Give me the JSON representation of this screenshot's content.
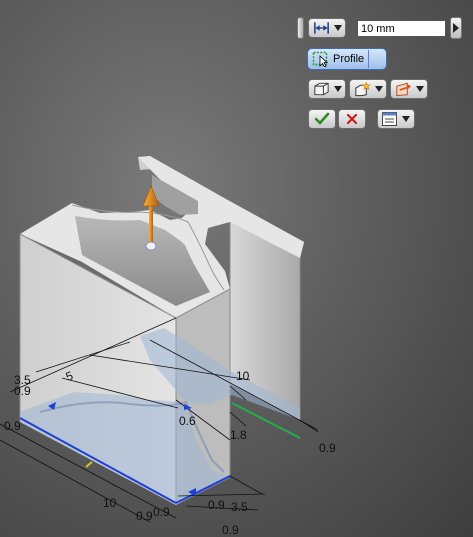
{
  "toolbar": {
    "distance_value": "10 mm",
    "profile_label": "Profile",
    "distance_icon": "extents-distance-icon",
    "output_icon": "output-solid-icon",
    "direction_icon": "direction-icon",
    "operation_icon": "join-operation-icon",
    "ok_icon": "check-icon",
    "cancel_icon": "cancel-x-icon",
    "more_icon": "options-menu-icon"
  },
  "dimensions": {
    "d_3_5_left": "3.5",
    "d_0_9_left_upper": "0.9",
    "d_0_9_left": "0.9",
    "d_5": "5",
    "d_10_top": "10",
    "d_0_6": "0.6",
    "d_1_8": "1.8",
    "d_0_9_right": "0.9",
    "d_10_bottom": "10",
    "d_0_9_bottom_a": "0.9",
    "d_0_9_bottom_b": "0.9",
    "d_0_9_bottom_c": "0.9",
    "d_3_5_bottom": "3.5",
    "d_0_9_bottom_d": "0.9"
  },
  "colors": {
    "sketch_edge_blue": "#1f3fd6",
    "sketch_edge_green": "#22b04a",
    "profile_fill": "#9fb6d6",
    "arrow_orange": "#e08a12",
    "solid_face": "#d4d4d4"
  }
}
